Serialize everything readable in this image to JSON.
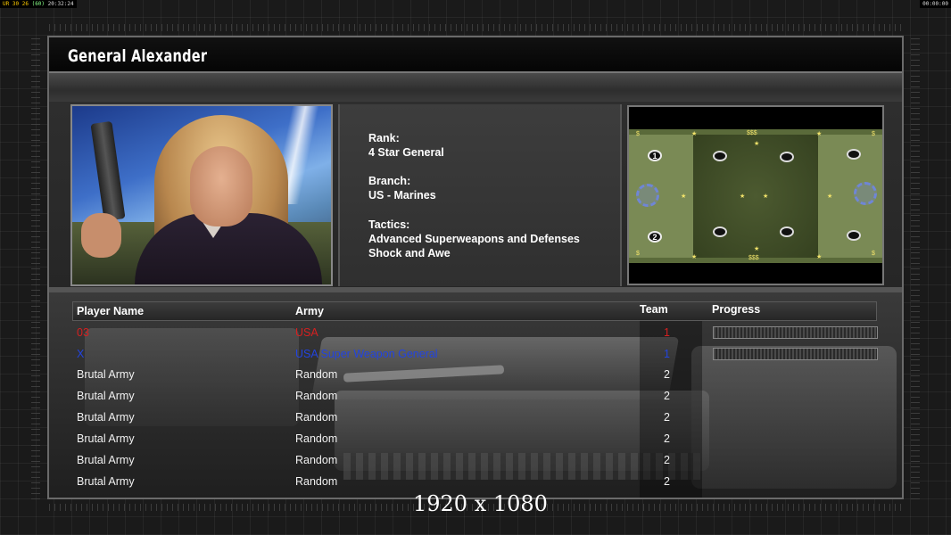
{
  "hud": {
    "left_a": "UR",
    "left_b": "30",
    "left_c": "26",
    "left_d": "(60)",
    "left_time": "20:32:24",
    "right_time": "00:00:00"
  },
  "general": {
    "name": "General Alexander",
    "rank_label": "Rank:",
    "rank_value": "4 Star General",
    "branch_label": "Branch:",
    "branch_value": "US - Marines",
    "tactics_label": "Tactics:",
    "tactics_line1": "Advanced Superweapons and Defenses",
    "tactics_line2": "Shock and Awe"
  },
  "map": {
    "slot1": "1",
    "slot2": "2",
    "money_top": "$$$",
    "money_bottom": "$$$",
    "star_glyph": "★",
    "dollar_glyph": "$"
  },
  "table": {
    "headers": {
      "player": "Player Name",
      "army": "Army",
      "team": "Team",
      "progress": "Progress"
    },
    "rows": [
      {
        "player": "03",
        "army": "USA",
        "team": "1",
        "color": "#d62020",
        "progress": 0
      },
      {
        "player": "X",
        "army": "USA Super Weapon General",
        "team": "1",
        "color": "#2244e0",
        "progress": 0
      },
      {
        "player": "Brutal Army",
        "army": "Random",
        "team": "2",
        "color": "#f0f0f0"
      },
      {
        "player": "Brutal Army",
        "army": "Random",
        "team": "2",
        "color": "#f0f0f0"
      },
      {
        "player": "Brutal Army",
        "army": "Random",
        "team": "2",
        "color": "#f0f0f0"
      },
      {
        "player": "Brutal Army",
        "army": "Random",
        "team": "2",
        "color": "#f0f0f0"
      },
      {
        "player": "Brutal Army",
        "army": "Random",
        "team": "2",
        "color": "#f0f0f0"
      },
      {
        "player": "Brutal Army",
        "army": "Random",
        "team": "2",
        "color": "#f0f0f0"
      }
    ]
  },
  "overlay": {
    "resolution": "1920 x 1080"
  }
}
